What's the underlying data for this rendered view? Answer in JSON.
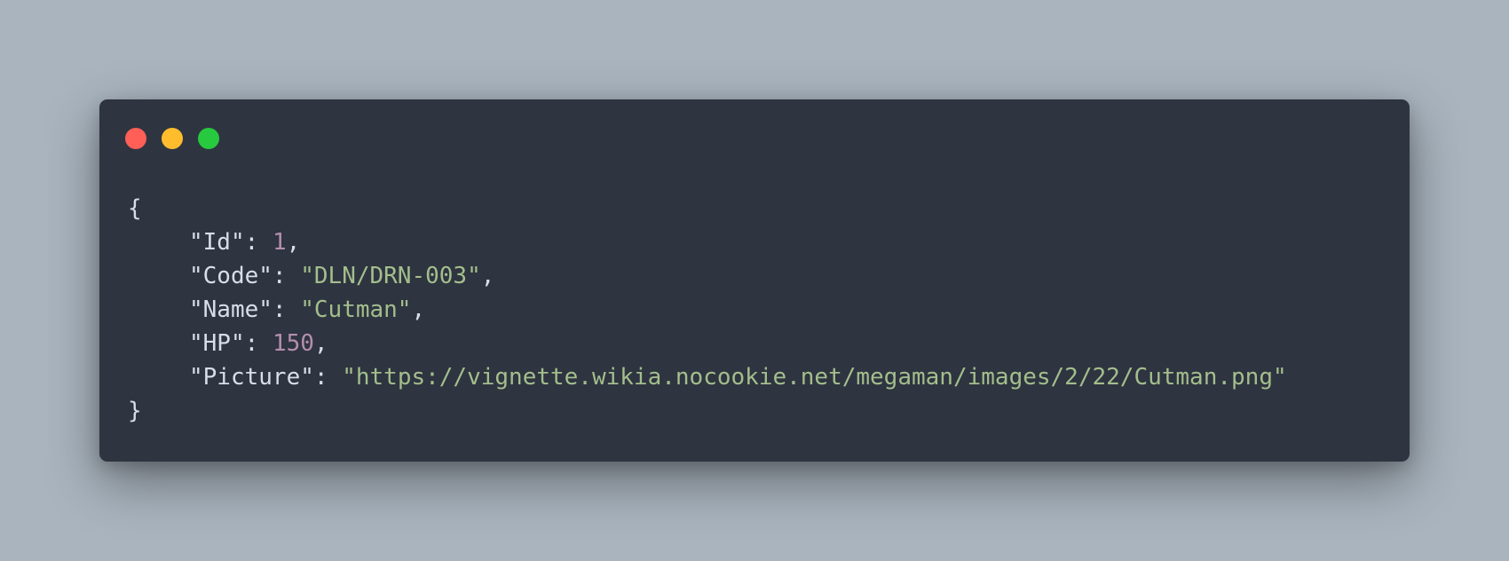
{
  "window": {
    "controls": [
      {
        "name": "close",
        "color": "#ff5f56"
      },
      {
        "name": "minimize",
        "color": "#ffbd2e"
      },
      {
        "name": "maximize",
        "color": "#27c93f"
      }
    ]
  },
  "colors": {
    "background": "#a9b4be",
    "editor": "#2e3440",
    "punctuation": "#d8dee9",
    "number": "#b48ead",
    "string": "#a3be8c"
  },
  "code": {
    "open_brace": "{",
    "close_brace": "}",
    "fields": [
      {
        "key": "\"Id\"",
        "value": "1",
        "type": "number",
        "comma": ","
      },
      {
        "key": "\"Code\"",
        "value": "\"DLN/DRN-003\"",
        "type": "string",
        "comma": ","
      },
      {
        "key": "\"Name\"",
        "value": "\"Cutman\"",
        "type": "string",
        "comma": ","
      },
      {
        "key": "\"HP\"",
        "value": "150",
        "type": "number",
        "comma": ","
      },
      {
        "key": "\"Picture\"",
        "value": "\"https://vignette.wikia.nocookie.net/megaman/images/2/22/Cutman.png\"",
        "type": "string",
        "comma": ""
      }
    ]
  }
}
